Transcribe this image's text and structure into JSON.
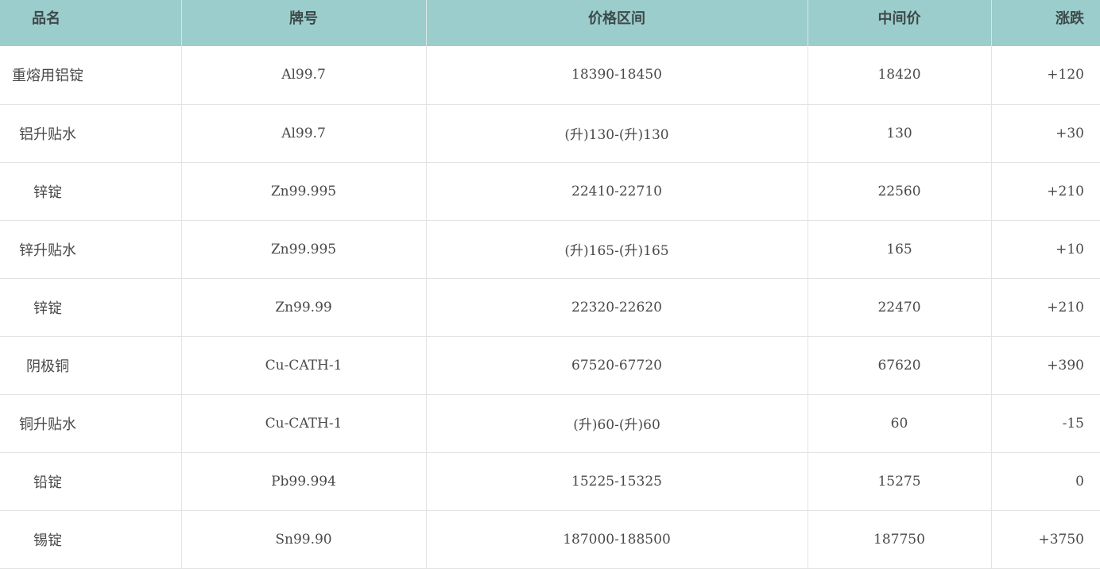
{
  "table": {
    "headers": [
      "品名",
      "牌号",
      "价格区间",
      "中间价",
      "涨跌"
    ],
    "rows": [
      [
        "重熔用铝锭",
        "Al99.7",
        "18390-18450",
        "18420",
        "+120"
      ],
      [
        "铝升贴水",
        "Al99.7",
        "(升)130-(升)130",
        "130",
        "+30"
      ],
      [
        "锌锭",
        "Zn99.995",
        "22410-22710",
        "22560",
        "+210"
      ],
      [
        "锌升贴水",
        "Zn99.995",
        "(升)165-(升)165",
        "165",
        "+10"
      ],
      [
        "锌锭",
        "Zn99.99",
        "22320-22620",
        "22470",
        "+210"
      ],
      [
        "阴极铜",
        "Cu-CATH-1",
        "67520-67720",
        "67620",
        "+390"
      ],
      [
        "铜升贴水",
        "Cu-CATH-1",
        "(升)60-(升)60",
        "60",
        "-15"
      ],
      [
        "铅锭",
        "Pb99.994",
        "15225-15325",
        "15275",
        "0"
      ],
      [
        "锡锭",
        "Sn99.90",
        "187000-188500",
        "187750",
        "+3750"
      ]
    ]
  },
  "colors": {
    "header_bg": "#9bcdcc",
    "header_text": "#3d4a4a",
    "cell_text": "#4a4a4a",
    "grid": "#e3e3e3"
  }
}
